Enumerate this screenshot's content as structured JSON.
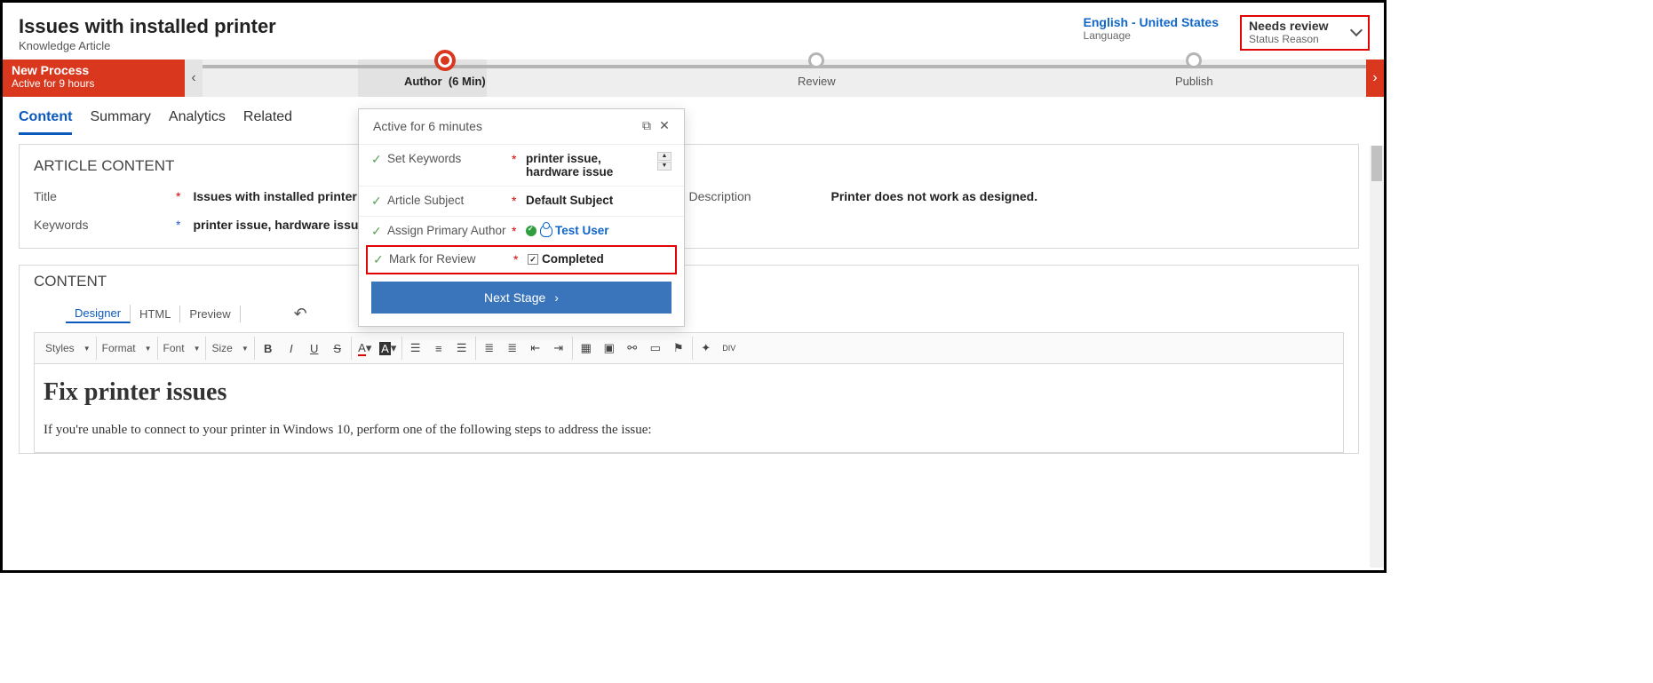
{
  "header": {
    "title": "Issues with installed printer",
    "subtitle": "Knowledge Article",
    "language_value": "English - United States",
    "language_label": "Language",
    "status_value": "Needs review",
    "status_label": "Status Reason"
  },
  "process": {
    "name": "New Process",
    "active_for": "Active for 9 hours",
    "stages": {
      "author": {
        "label": "Author",
        "time": "(6 Min)"
      },
      "review": {
        "label": "Review"
      },
      "publish": {
        "label": "Publish"
      }
    }
  },
  "tabs": [
    "Content",
    "Summary",
    "Analytics",
    "Related"
  ],
  "article": {
    "section_title": "ARTICLE CONTENT",
    "title_label": "Title",
    "title_value": "Issues with installed printer",
    "description_label": "Description",
    "description_value": "Printer does not work as designed.",
    "keywords_label": "Keywords",
    "keywords_value": "printer issue, hardware issue"
  },
  "content_section": {
    "title": "CONTENT",
    "editor_tabs": [
      "Designer",
      "HTML",
      "Preview"
    ],
    "toolbar": {
      "styles": "Styles",
      "format": "Format",
      "font": "Font",
      "size": "Size"
    },
    "body_heading": "Fix printer issues",
    "body_text": "If you're unable to connect to your printer in Windows 10, perform one of the following steps to address the issue:"
  },
  "flyout": {
    "active_text": "Active for 6 minutes",
    "rows": {
      "keywords": {
        "label": "Set Keywords",
        "value": "printer issue, hardware issue"
      },
      "subject": {
        "label": "Article Subject",
        "value": "Default Subject"
      },
      "author": {
        "label": "Assign Primary Author",
        "value": "Test User"
      },
      "review": {
        "label": "Mark for Review",
        "value": "Completed"
      }
    },
    "next_label": "Next Stage"
  }
}
